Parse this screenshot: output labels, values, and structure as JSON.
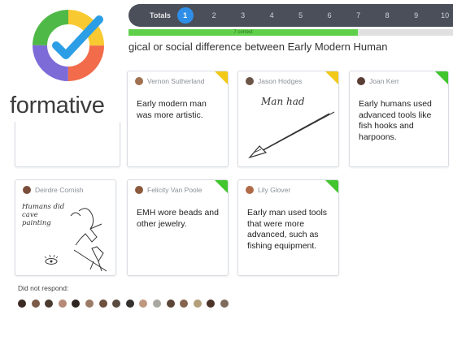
{
  "brand": {
    "name": "formative"
  },
  "topbar": {
    "totals_label": "Totals",
    "pages": [
      "1",
      "2",
      "3",
      "4",
      "5",
      "6",
      "7",
      "8",
      "9",
      "10"
    ],
    "active_page": "1",
    "progress_text": "7 correct",
    "progress_fraction": 0.7
  },
  "question": {
    "text": "gical or social difference between Early Modern Human"
  },
  "responses": [
    {
      "author": "Vernon Sutherland",
      "answer": "Early modern man was more artistic.",
      "status": "yellow"
    },
    {
      "author": "Jason Hodges",
      "answer": "Man had",
      "status": "yellow",
      "drawing": "spear"
    },
    {
      "author": "Joan Kerr",
      "answer": "Early humans used advanced tools like fish hooks and harpoons.",
      "status": "green"
    },
    {
      "author": "Deirdre Cornish",
      "answer": "Humans did cave painting",
      "drawing": "cave-painting"
    },
    {
      "author": "Felicity Van Poole",
      "answer": "EMH wore beads and other jewelry.",
      "status": "green"
    },
    {
      "author": "Lily Glover",
      "answer": "Early man used tools that were more advanced, such as fishing equipment.",
      "status": "green"
    }
  ],
  "did_not_respond": {
    "label": "Did not respond:",
    "count": 16
  },
  "colors": {
    "accent_blue": "#2f8fe8",
    "correct_green": "#42c52f",
    "pending_yellow": "#f2c917",
    "topbar": "#4a4f5a"
  }
}
